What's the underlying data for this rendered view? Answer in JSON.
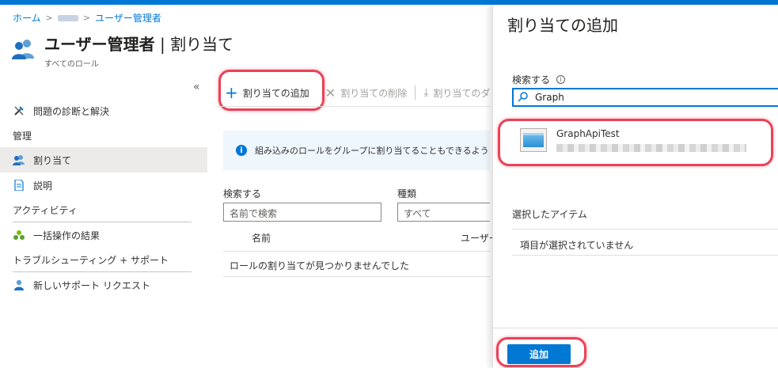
{
  "breadcrumb": {
    "home": "ホーム",
    "current": "ユーザー管理者"
  },
  "header": {
    "title_main": "ユーザー管理者",
    "title_sep": " | ",
    "title_sub": "割り当て",
    "subtitle": "すべてのロール"
  },
  "collapse_glyph": "«",
  "sidebar": {
    "diagnose": "問題の診断と解決",
    "manage_header": "管理",
    "assignments": "割り当て",
    "description": "説明",
    "activity_header": "アクティビティ",
    "bulk_results": "一括操作の結果",
    "troubleshoot_header": "トラブルシューティング + サポート",
    "new_support": "新しいサポート リクエスト"
  },
  "toolbar": {
    "add": "割り当ての追加",
    "remove": "割り当ての削除",
    "download": "割り当てのダ"
  },
  "info_banner": "組み込みのロールをグループに割り当てることもできるようになりました",
  "filters": {
    "search_label": "検索する",
    "search_placeholder": "名前で検索",
    "type_label": "種類",
    "type_value": "すべて"
  },
  "table": {
    "col_name": "名前",
    "col_user": "ユーザー",
    "empty": "ロールの割り当てが見つかりませんでした"
  },
  "panel": {
    "title": "割り当ての追加",
    "search_label": "検索する",
    "search_value": "Graph",
    "result_name": "GraphApiTest",
    "selected_label": "選択したアイテム",
    "selected_empty": "項目が選択されていません",
    "add_button": "追加"
  },
  "colors": {
    "accent": "#0078d4",
    "highlight": "#e8203a"
  }
}
